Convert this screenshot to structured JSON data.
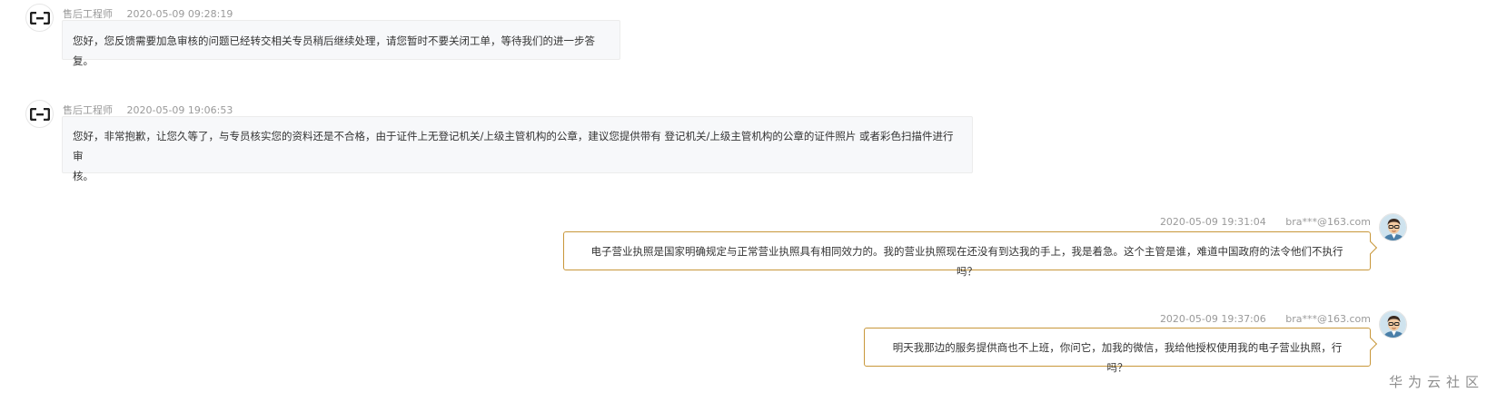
{
  "messages": [
    {
      "sender": "售后工程师",
      "timestamp": "2020-05-09 09:28:19",
      "text": "您好，您反馈需要加急审核的问题已经转交相关专员稍后继续处理，请您暂时不要关闭工单，等待我们的进一步答复。"
    },
    {
      "sender": "售后工程师",
      "timestamp": "2020-05-09 19:06:53",
      "text_line1": "您好，非常抱歉，让您久等了，与专员核实您的资料还是不合格，由于证件上无登记机关/上级主管机构的公章，建议您提供带有 登记机关/上级主管机构的公章的证件照片 或者彩色扫描件进行审",
      "text_line2": "核。"
    },
    {
      "sender": "bra***@163.com",
      "timestamp": "2020-05-09 19:31:04",
      "text": "电子营业执照是国家明确规定与正常营业执照具有相同效力的。我的营业执照现在还没有到达我的手上，我是着急。这个主管是谁，难道中国政府的法令他们不执行吗？"
    },
    {
      "sender": "bra***@163.com",
      "timestamp": "2020-05-09 19:37:06",
      "text": "明天我那边的服务提供商也不上班，你问它，加我的微信，我给他授权使用我的电子营业执照，行吗？"
    }
  ],
  "watermark": "华为云社区",
  "colors": {
    "agent_bubble_bg": "#f7f8fa",
    "user_bubble_border": "#c8973a",
    "meta_text": "#9a9a9a"
  },
  "icons": {
    "agent_avatar": "aliyun-logo-icon",
    "user_avatar": "user-avatar-icon"
  }
}
